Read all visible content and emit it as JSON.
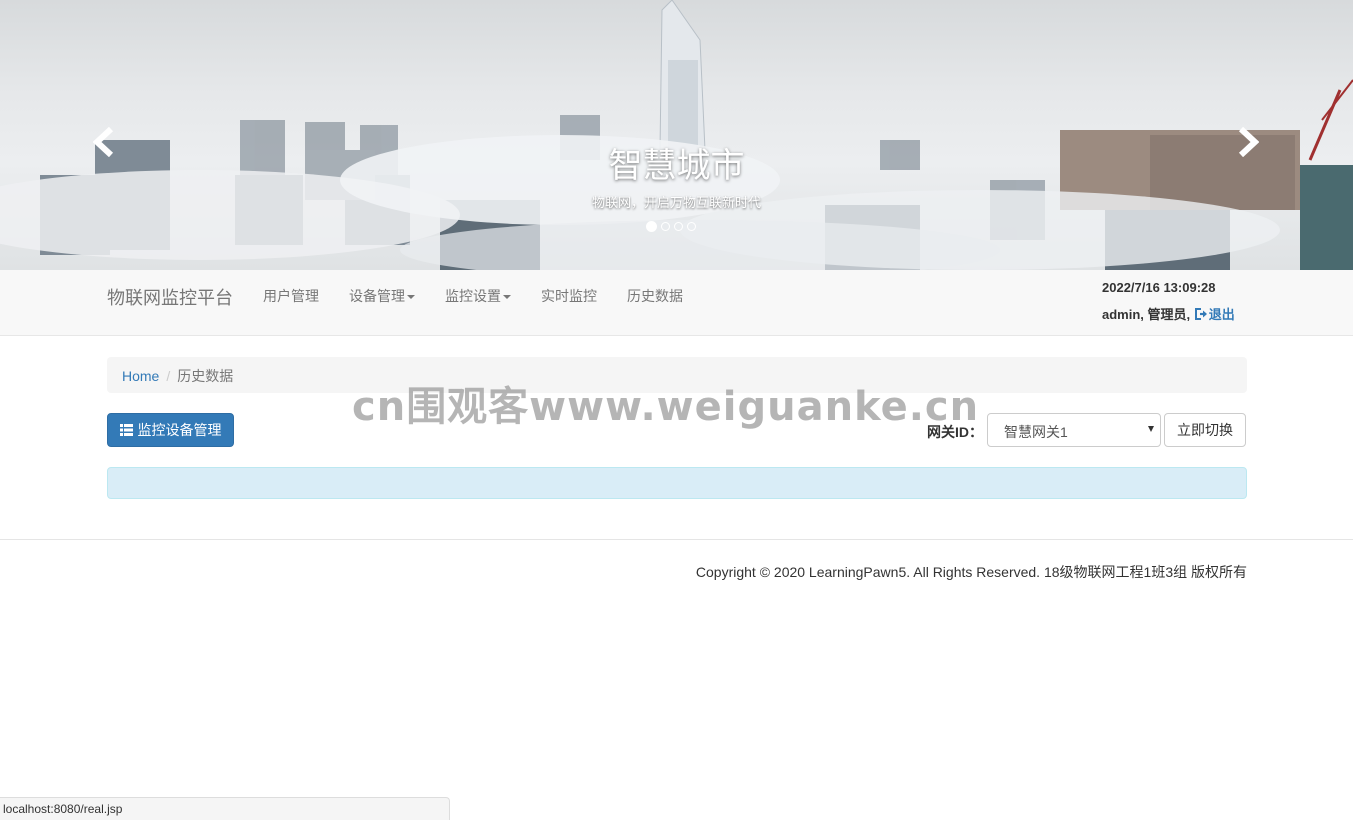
{
  "carousel": {
    "title": "智慧城市",
    "subtitle": "物联网，开启万物互联新时代",
    "slide_count": 4,
    "active_index": 0
  },
  "navbar": {
    "brand": "物联网监控平台",
    "items": [
      {
        "label": "用户管理",
        "dropdown": false
      },
      {
        "label": "设备管理",
        "dropdown": true
      },
      {
        "label": "监控设置",
        "dropdown": true
      },
      {
        "label": "实时监控",
        "dropdown": false
      },
      {
        "label": "历史数据",
        "dropdown": false
      }
    ],
    "datetime": "2022/7/16 13:09:28",
    "user": "admin, 管理员,",
    "logout_label": "退出"
  },
  "breadcrumb": {
    "home": "Home",
    "current": "历史数据"
  },
  "watermark": "cn围观客www.weiguanke.cn",
  "toolbar": {
    "manage_button": "监控设备管理",
    "gateway_label": "网关ID：",
    "gateway_selected": "智慧网关1",
    "switch_button": "立即切换"
  },
  "footer": {
    "copyright": "Copyright © 2020 LearningPawn5. All Rights Reserved. 18级物联网工程1班3组 版权所有"
  },
  "statusbar": {
    "url": "localhost:8080/real.jsp"
  },
  "colors": {
    "primary": "#337ab7",
    "alert_info_bg": "#d9edf7",
    "navbar_bg": "#f8f8f8"
  }
}
